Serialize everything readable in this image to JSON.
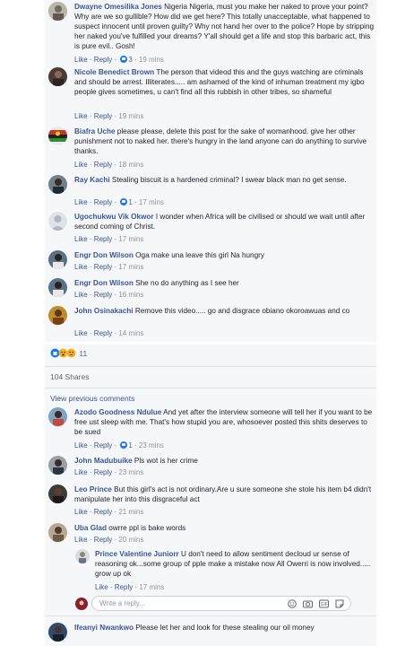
{
  "comments_top": [
    {
      "name": "Dwayne Omesilika Jones",
      "text": "Nigeria Nigeria, must you make her naked to prove your point? Why are we so gullible? How did we get here? This totally unacceptable, what happened to suspect innocent until proven guilty? Why not hand her over to the police? Hope by stripping her naked you've fulfilled your dreams? Y'all should get a life and stop this barbaric act, this is pure evil.. Gosh!",
      "like": "Like",
      "reply": "Reply",
      "reactions": "3",
      "time": "19 mins"
    },
    {
      "name": "Nicole Benedict Brown",
      "text": "The person that videod this and the guys watching are criminals and should be arrest. Illiterates..... am ashamed of the kind of inhuman treatment my igbo people gives sometimes, u can't find all this rubbish in other tribes, so shameful",
      "like": "Like",
      "reply": "Reply",
      "time": "19 mins"
    },
    {
      "name": "Biafra Uche",
      "text": "please please, delete this post for the sake of womanhood. give her other punishment not to naked her. there's hungry in the land anyone can do anything to survive thanks.",
      "like": "Like",
      "reply": "Reply",
      "time": "18 mins"
    },
    {
      "name": "Ray Kachi",
      "text": "Stealing biscuit is a hardened criminal? I swear black man no get sense.",
      "like": "Like",
      "reply": "Reply",
      "reactions": "1",
      "time": "17 mins"
    },
    {
      "name": "Ugochukwu Vik Okwor",
      "text": "I wonder when Africa will be civilised or should we wait until after second coming of Christ.",
      "like": "Like",
      "reply": "Reply",
      "time": "17 mins"
    },
    {
      "name": "Engr Don Wilson",
      "text": "Oga make una leave this girl Na hungry",
      "like": "Like",
      "reply": "Reply",
      "time": "17 mins"
    },
    {
      "name": "Engr Don Wilson",
      "text": "She no do anything as I see her",
      "like": "Like",
      "reply": "Reply",
      "time": "16 mins"
    },
    {
      "name": "John Osinakachi",
      "text": "Remove this video..... go and disgrace obiano okoroawuas and co",
      "like": "Like",
      "reply": "Reply",
      "time": "14 mins"
    }
  ],
  "post_footer": {
    "reaction_count": "11",
    "shares": "104 Shares",
    "view_previous": "View previous comments"
  },
  "comments_bottom": [
    {
      "name": "Azodo Goodness Ndulue",
      "text": "And yet after the interview someone will tell her if you want to be free ust sleep with me. That's how stupid you are, whosoever posted this shits deserves to be sued",
      "like": "Like",
      "reply": "Reply",
      "reactions": "1",
      "time": "23 mins"
    },
    {
      "name": "John Madubuike",
      "text": "Pls wot is her crime",
      "like": "Like",
      "reply": "Reply",
      "time": "23 mins"
    },
    {
      "name": "Leo Prince",
      "text": "But this girl's act is not ordinary.Are u sure someone she stole his item b4 didn't manipulate her into this disgraceful act",
      "like": "Like",
      "reply": "Reply",
      "time": "21 mins"
    },
    {
      "name": "Uba Glad",
      "text": "owrre ppl is bake words",
      "like": "Like",
      "reply": "Reply",
      "time": "20 mins"
    }
  ],
  "reply_comment": {
    "name": "Prince Valentine Juniorr",
    "text": "U don't need to allow sentiment decloud ur sense of reasoning ok...some group of pple make a mistake now All Owerri is now involved..... grow up ok",
    "like": "Like",
    "reply": "Reply",
    "time": "17 mins"
  },
  "composer": {
    "placeholder": "Write a reply..."
  },
  "last_comment": {
    "name": "Ifeanyi Nwankwo",
    "text": "Please let her and look for these stealing our oil money"
  },
  "colors": {
    "link": "#385898",
    "meta": "#90949c",
    "accent": "#1877f2"
  }
}
